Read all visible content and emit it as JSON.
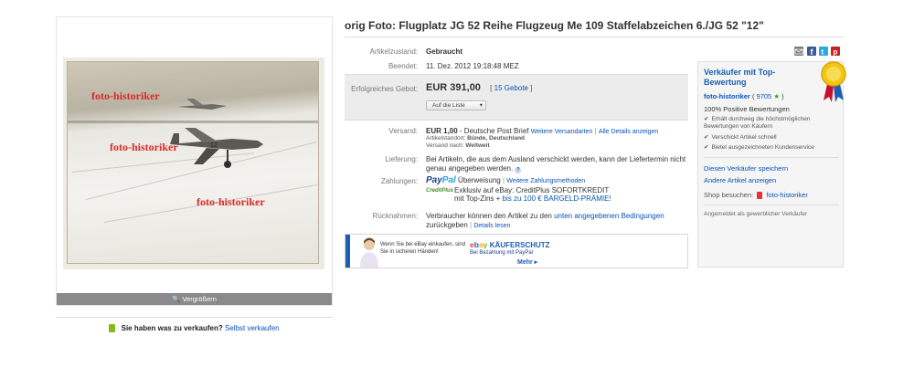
{
  "listing": {
    "title": "orig Foto: Flugplatz JG 52 Reihe Flugzeug Me 109 Staffelabzeichen 6./JG 52 \"12\"",
    "image_watermark": "foto-historiker",
    "zoom_label": "Vergrößern"
  },
  "sell": {
    "question": "Sie haben was zu verkaufen?",
    "link": "Selbst verkaufen"
  },
  "details": {
    "condition_label": "Artikelzustand:",
    "condition_value": "Gebraucht",
    "ended_label": "Beendet:",
    "ended_value": "11. Dez. 2012 19:18:48 MEZ",
    "price_label": "Erfolgreiches Gebot:",
    "price_value": "EUR 391,00",
    "bids_bracket_open": "[",
    "bids_link": "15 Gebote",
    "bids_bracket_close": "]",
    "watch_button": "Auf die Liste",
    "shipping_label": "Versand:",
    "shipping_price": "EUR 1,00",
    "shipping_method": " - Deutsche Post Brief",
    "shipping_more_link": "Weitere Versandarten",
    "shipping_sep": "|",
    "shipping_details_link": "Alle Details anzeigen",
    "location_label": "Artikelstandort:",
    "location_value": "Bünde, Deutschland",
    "ships_to_label": "Versand nach:",
    "ships_to_value": "Weltweit",
    "delivery_label": "Lieferung:",
    "delivery_text": "Bei Artikeln, die aus dem Ausland verschickt werden, kann der Liefertermin nicht genau angegeben werden.",
    "payment_label": "Zahlungen:",
    "paypal_text": "Überweisung",
    "payment_sep": "|",
    "payment_more_link": "Weitere Zahlungsmethoden",
    "creditplus_logo": "CreditPlus",
    "creditplus_line1": "Exklusiv auf eBay: CreditPlus SOFORTKREDIT",
    "creditplus_line2_pre": "mit Top-Zins + ",
    "creditplus_line2_link": "bis zu 100 € BARGELD-PRÄMIE!",
    "returns_label": "Rücknahmen:",
    "returns_text_pre": "Verbraucher können den Artikel zu den ",
    "returns_link": "unten angegebenen Bedingungen",
    "returns_text_post": " zurückgeben",
    "returns_sep": "|",
    "returns_details_link": "Details lesen"
  },
  "buyer_protection": {
    "text": "Wenn Sie bei eBay einkaufen, sind Sie in sicheren Händen!",
    "title": "KÄUFERSCHUTZ",
    "sub": "Bei Bezahlung mit PayPal",
    "more": "Mehr ▸"
  },
  "share_icons": [
    "mail-icon",
    "facebook-icon",
    "twitter-icon",
    "pinterest-icon"
  ],
  "seller": {
    "heading": "Verkäufer mit Top-Bewertung",
    "name": "foto-historiker",
    "score_open": "(",
    "score": "9705",
    "score_close": ")",
    "positive": "100% Positive Bewertungen",
    "bullets": [
      "Erhält durchweg die höchstmöglichen Bewertungen von Käufern",
      "Verschickt Artikel schnell",
      "Bietet ausgezeichneten Kundenservice"
    ],
    "save_link": "Diesen Verkäufer speichern",
    "other_link": "Andere Artikel anzeigen",
    "shop_label": "Shop besuchen:",
    "shop_name": "foto-historiker",
    "registered": "Angemeldet als gewerblicher Verkäufer"
  },
  "colors": {
    "link": "#0654ba",
    "paypal_dark": "#1a3f8c",
    "paypal_light": "#2aa2dc",
    "accent_red": "#d92b2b"
  }
}
